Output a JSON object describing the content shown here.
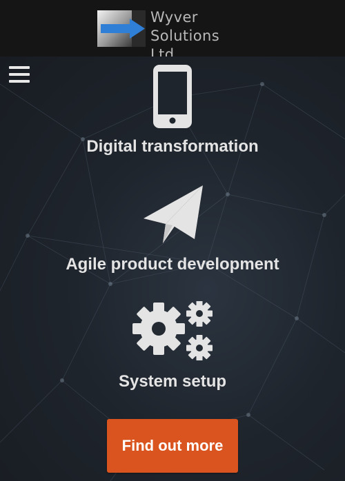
{
  "header": {
    "logo_line1": "Wyver",
    "logo_line2": "Solutions Ltd",
    "logo_icon": "arrow-logo-icon"
  },
  "nav": {
    "menu_icon": "hamburger-menu-icon"
  },
  "features": [
    {
      "title": "Digital transformation",
      "icon": "smartphone-icon"
    },
    {
      "title": "Agile product development",
      "icon": "paper-plane-icon"
    },
    {
      "title": "System setup",
      "icon": "gears-icon"
    }
  ],
  "cta": {
    "label": "Find out more"
  },
  "colors": {
    "header_bg": "#151515",
    "hero_bg": "#1f252d",
    "text": "#e4e4e4",
    "accent": "#d9541e",
    "logo_arrow": "#2f7fd6"
  }
}
